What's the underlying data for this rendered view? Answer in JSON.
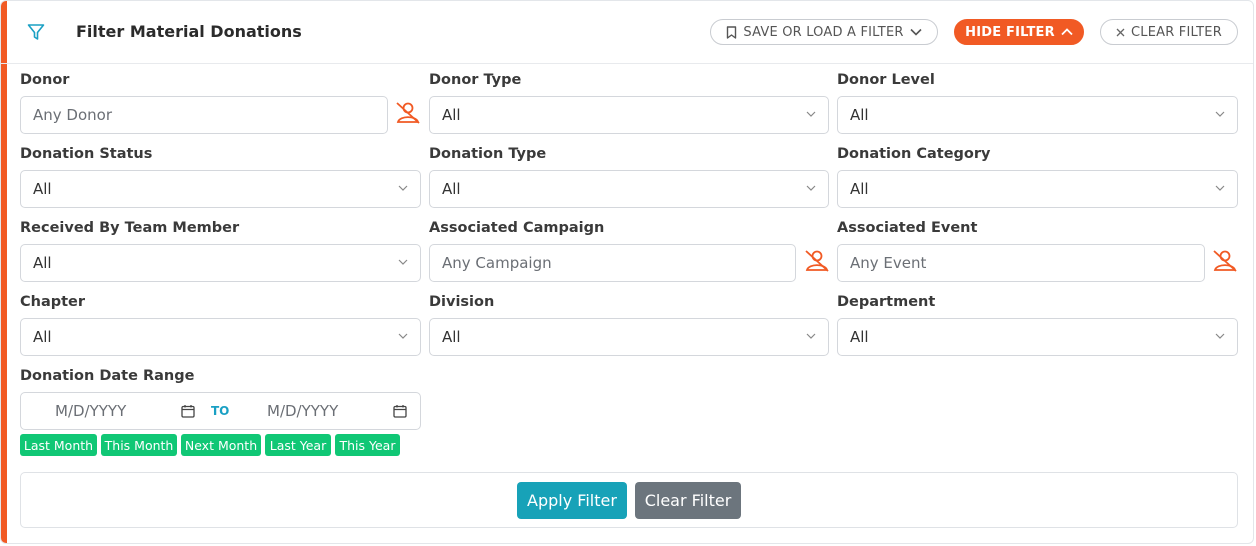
{
  "header": {
    "title": "Filter Material Donations",
    "save_label": "SAVE OR LOAD A FILTER",
    "hide_label": "HIDE FILTER",
    "clear_label": "CLEAR FILTER"
  },
  "colors": {
    "accent": "#f15a24",
    "chip": "#10c775",
    "apply": "#17a2b8",
    "clear": "#6c757d"
  },
  "fields": {
    "donor": {
      "label": "Donor",
      "placeholder": "Any Donor"
    },
    "donor_type": {
      "label": "Donor Type",
      "value": "All"
    },
    "donor_level": {
      "label": "Donor Level",
      "value": "All"
    },
    "donation_status": {
      "label": "Donation Status",
      "value": "All"
    },
    "donation_type": {
      "label": "Donation Type",
      "value": "All"
    },
    "donation_category": {
      "label": "Donation Category",
      "value": "All"
    },
    "received_by": {
      "label": "Received By Team Member",
      "value": "All"
    },
    "campaign": {
      "label": "Associated Campaign",
      "placeholder": "Any Campaign"
    },
    "event": {
      "label": "Associated Event",
      "placeholder": "Any Event"
    },
    "chapter": {
      "label": "Chapter",
      "value": "All"
    },
    "division": {
      "label": "Division",
      "value": "All"
    },
    "department": {
      "label": "Department",
      "value": "All"
    }
  },
  "date_range": {
    "label": "Donation Date Range",
    "from_placeholder": "M/D/YYYY",
    "to_label": "TO",
    "to_placeholder": "M/D/YYYY",
    "presets": [
      "Last Month",
      "This Month",
      "Next Month",
      "Last Year",
      "This Year"
    ]
  },
  "footer": {
    "apply_label": "Apply Filter",
    "clear_label": "Clear Filter"
  }
}
